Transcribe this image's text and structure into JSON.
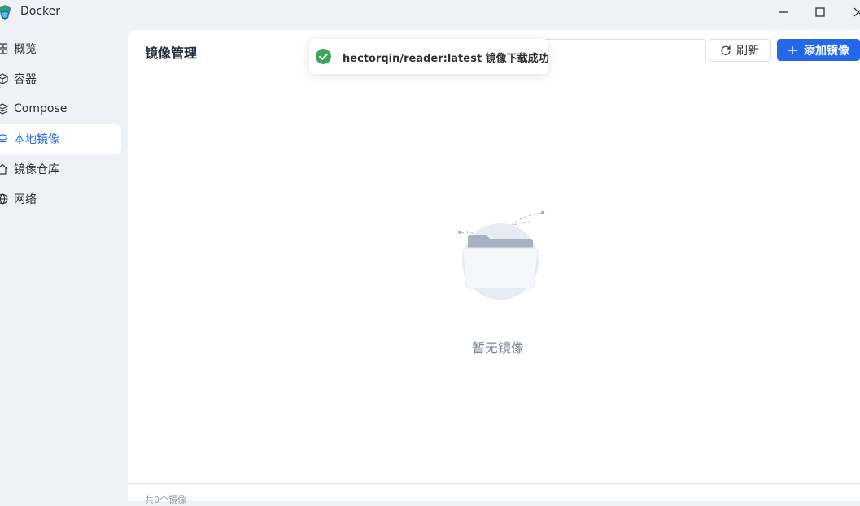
{
  "window": {
    "title": "Docker",
    "minimize_icon": "minimize-icon",
    "maximize_icon": "maximize-icon",
    "close_icon": "close-icon"
  },
  "sidebar": {
    "items": [
      {
        "label": "概览",
        "icon": "grid-icon",
        "active": false
      },
      {
        "label": "容器",
        "icon": "cube-icon",
        "active": false
      },
      {
        "label": "Compose",
        "icon": "layers-icon",
        "active": false
      },
      {
        "label": "本地镜像",
        "icon": "image-icon",
        "active": true
      },
      {
        "label": "镜像仓库",
        "icon": "house-icon",
        "active": false
      },
      {
        "label": "网络",
        "icon": "globe-icon",
        "active": false
      }
    ]
  },
  "main": {
    "title": "镜像管理",
    "search_placeholder": "",
    "refresh_label": "刷新",
    "add_label": "添加镜像",
    "empty_text": "暂无镜像",
    "footer_text": "共0个镜像"
  },
  "toast": {
    "message": "hectorqin/reader:latest 镜像下载成功",
    "icon": "check-circle-icon"
  },
  "colors": {
    "accent": "#2467e8",
    "success": "#3aa55b",
    "background": "#eef1f6"
  }
}
